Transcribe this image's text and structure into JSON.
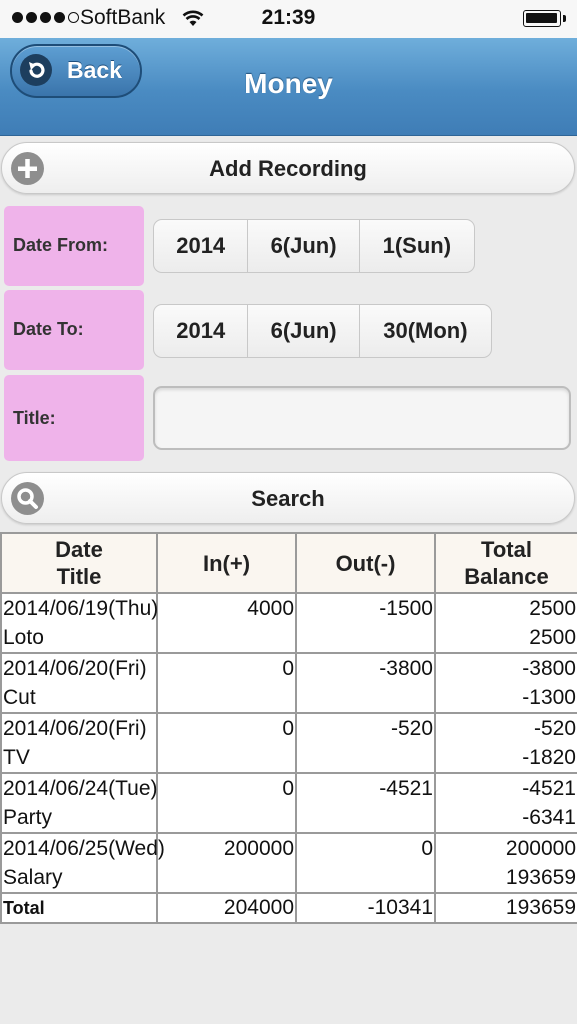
{
  "status_bar": {
    "carrier": "SoftBank",
    "time": "21:39"
  },
  "header": {
    "back_label": "Back",
    "title": "Money"
  },
  "add_button": {
    "label": "Add Recording"
  },
  "date_from": {
    "label": "Date From:",
    "year": "2014",
    "month": "6(Jun)",
    "day": "1(Sun)"
  },
  "date_to": {
    "label": "Date To:",
    "year": "2014",
    "month": "6(Jun)",
    "day": "30(Mon)"
  },
  "title_field": {
    "label": "Title:",
    "value": ""
  },
  "search_button": {
    "label": "Search"
  },
  "table": {
    "headers": {
      "date": "Date",
      "title": "Title",
      "in": "In(+)",
      "out": "Out(-)",
      "total": "Total",
      "balance": "Balance"
    },
    "rows": [
      {
        "date": "2014/06/19(Thu)",
        "title": "Loto",
        "in": "4000",
        "out": "-1500",
        "total": "2500",
        "balance": "2500"
      },
      {
        "date": "2014/06/20(Fri)",
        "title": "Cut",
        "in": "0",
        "out": "-3800",
        "total": "-3800",
        "balance": "-1300"
      },
      {
        "date": "2014/06/20(Fri)",
        "title": "TV",
        "in": "0",
        "out": "-520",
        "total": "-520",
        "balance": "-1820"
      },
      {
        "date": "2014/06/24(Tue)",
        "title": "Party",
        "in": "0",
        "out": "-4521",
        "total": "-4521",
        "balance": "-6341"
      },
      {
        "date": "2014/06/25(Wed)",
        "title": "Salary",
        "in": "200000",
        "out": "0",
        "total": "200000",
        "balance": "193659"
      }
    ],
    "total_row": {
      "label": "Total",
      "in": "204000",
      "out": "-10341",
      "balance": "193659"
    }
  }
}
